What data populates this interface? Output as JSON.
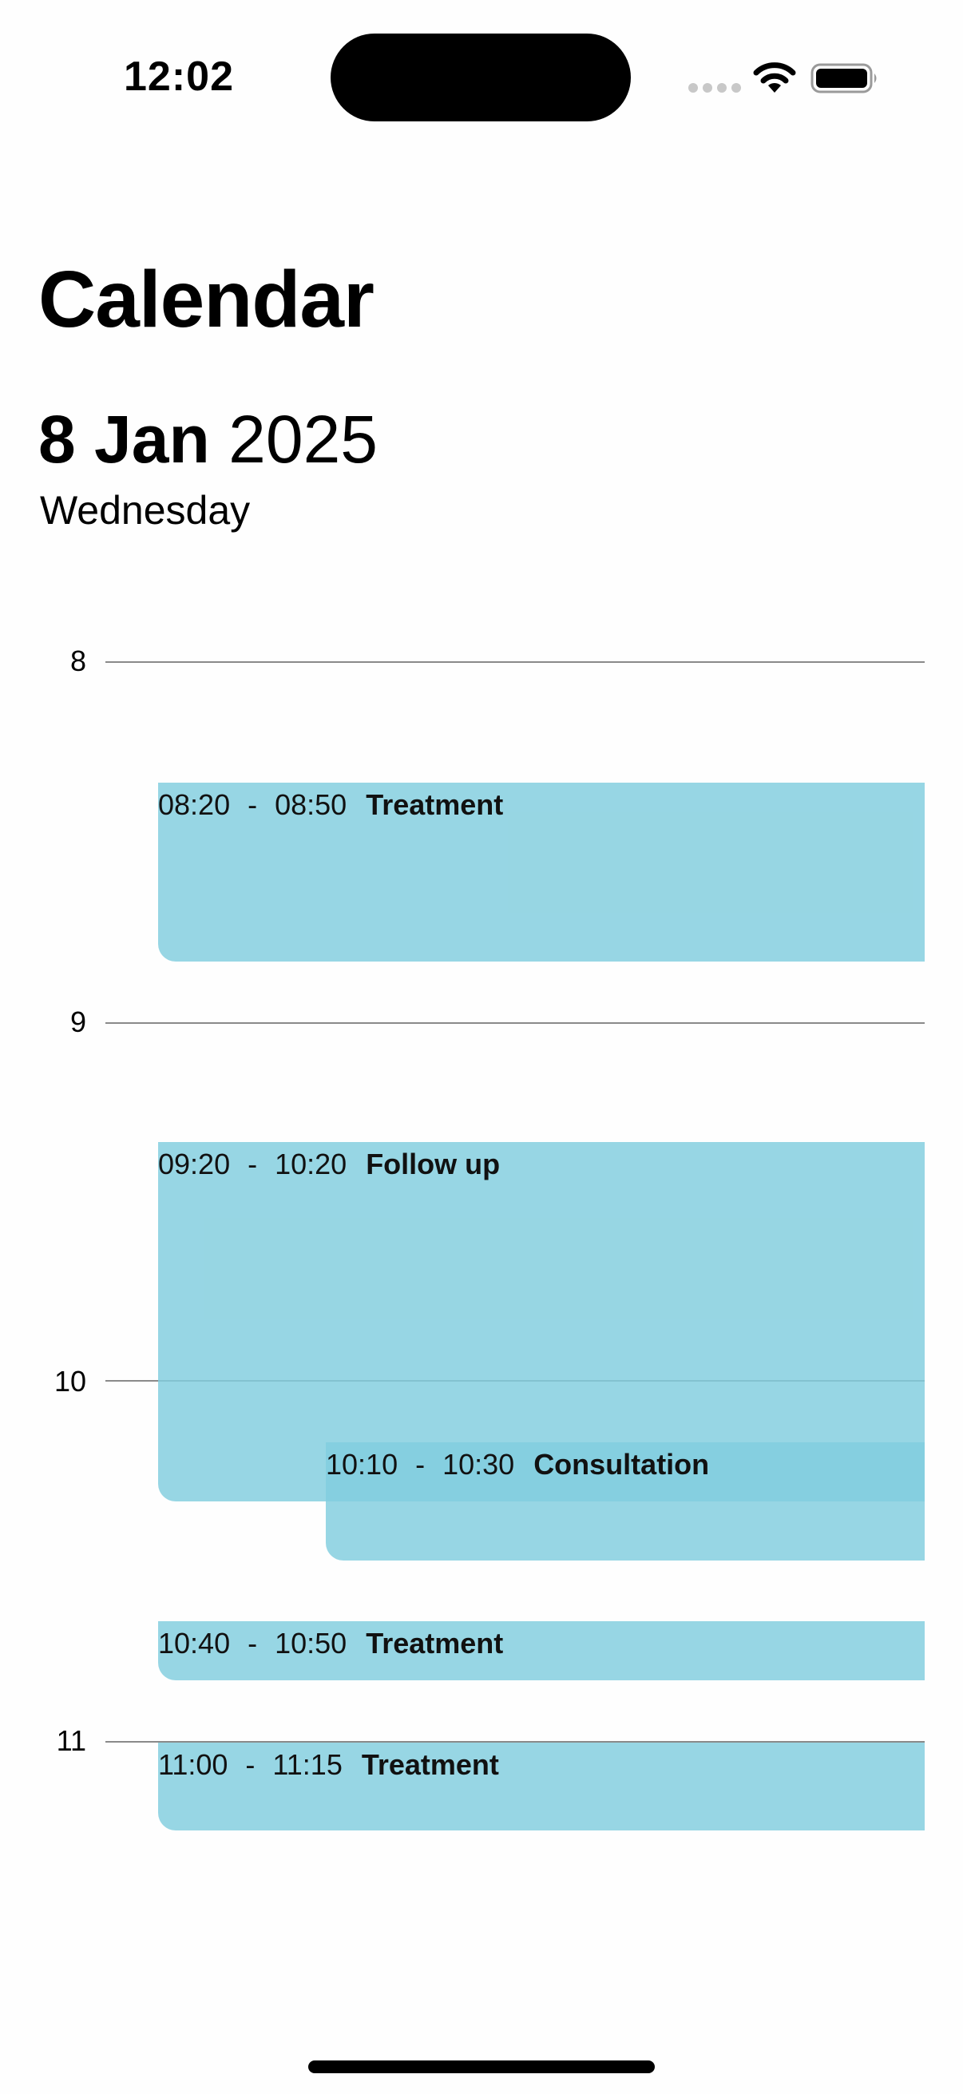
{
  "status_bar": {
    "time": "12:02",
    "icons": [
      "signal-dots-icon",
      "wifi-icon",
      "battery-icon"
    ]
  },
  "header": {
    "title": "Calendar",
    "date_day_month": "8 Jan",
    "date_year": "2025",
    "weekday": "Wednesday"
  },
  "timeline": {
    "hours": [
      "8",
      "9",
      "10",
      "11"
    ]
  },
  "events": [
    {
      "start": "08:20",
      "separator": "-",
      "end": "08:50",
      "title": "Treatment"
    },
    {
      "start": "09:20",
      "separator": "-",
      "end": "10:20",
      "title": "Follow up"
    },
    {
      "start": "10:10",
      "separator": "-",
      "end": "10:30",
      "title": "Consultation"
    },
    {
      "start": "10:40",
      "separator": "-",
      "end": "10:50",
      "title": "Treatment"
    },
    {
      "start": "11:00",
      "separator": "-",
      "end": "11:15",
      "title": "Treatment"
    }
  ],
  "colors": {
    "event_fill": "#82CEDE",
    "grid_line": "#8A8A8A",
    "text": "#000000"
  }
}
